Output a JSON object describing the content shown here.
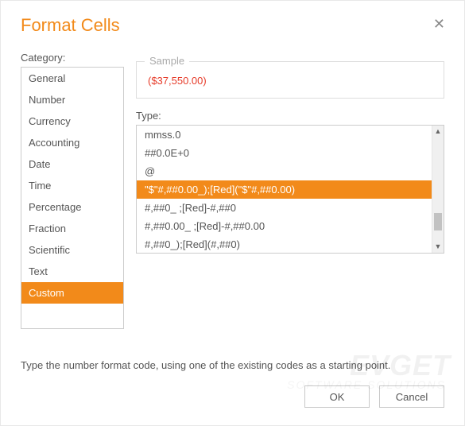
{
  "dialog": {
    "title": "Format Cells",
    "hint": "Type the number format code, using one of the existing codes as a starting point."
  },
  "category": {
    "label": "Category:",
    "items": [
      "General",
      "Number",
      "Currency",
      "Accounting",
      "Date",
      "Time",
      "Percentage",
      "Fraction",
      "Scientific",
      "Text",
      "Custom"
    ],
    "selected_index": 10
  },
  "sample": {
    "legend": "Sample",
    "value": "($37,550.00)"
  },
  "type": {
    "label": "Type:",
    "items": [
      "mmss.0",
      "##0.0E+0",
      "@",
      "\"$\"#,##0.00_);[Red](\"$\"#,##0.00)",
      "#,##0_ ;[Red]-#,##0",
      "#,##0.00_ ;[Red]-#,##0.00",
      "#,##0_);[Red](#,##0)"
    ],
    "selected_index": 3
  },
  "footer": {
    "ok": "OK",
    "cancel": "Cancel"
  },
  "watermark": {
    "main": "EVGET",
    "sub": "SOFTWARE SOLUTIONS"
  },
  "colors": {
    "accent": "#f28a1a",
    "sample_text": "#e63a28"
  }
}
